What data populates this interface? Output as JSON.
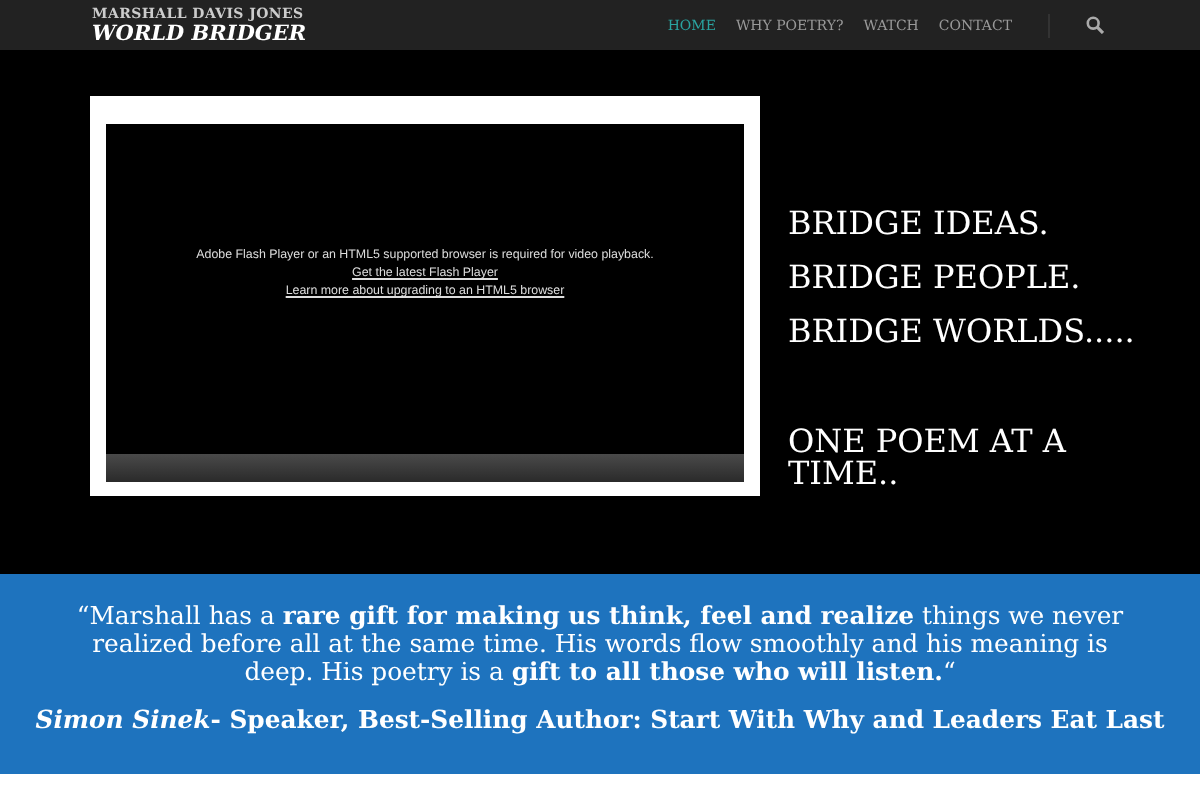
{
  "header": {
    "logo_top": "MARSHALL DAVIS JONES",
    "logo_bottom": "WORLD BRIDGER",
    "nav": [
      {
        "label": "HOME",
        "selected": true
      },
      {
        "label": "WHY POETRY?",
        "selected": false
      },
      {
        "label": "WATCH",
        "selected": false
      },
      {
        "label": "CONTACT",
        "selected": false
      }
    ]
  },
  "video": {
    "message": "Adobe Flash Player or an HTML5 supported browser is required for video playback.",
    "links": [
      "Get the latest Flash Player ",
      "Learn more about upgrading to an HTML5 browser"
    ]
  },
  "taglines": [
    "BRIDGE IDEAS.",
    "BRIDGE PEOPLE.",
    "BRIDGE WORLDS....."
  ],
  "closing": "ONE POEM AT A TIME..",
  "testimonial": {
    "quote": "“Marshall has a **rare gift for making us think, feel and realize** things we never realized before all at the same time. His words flow smoothly and his meaning is deep. His poetry is a **gift to all those who will listen.**“",
    "attribution": "*Simon Sinek*- Speaker, Best-Selling Author: Start With Why and Leaders Eat Last"
  }
}
